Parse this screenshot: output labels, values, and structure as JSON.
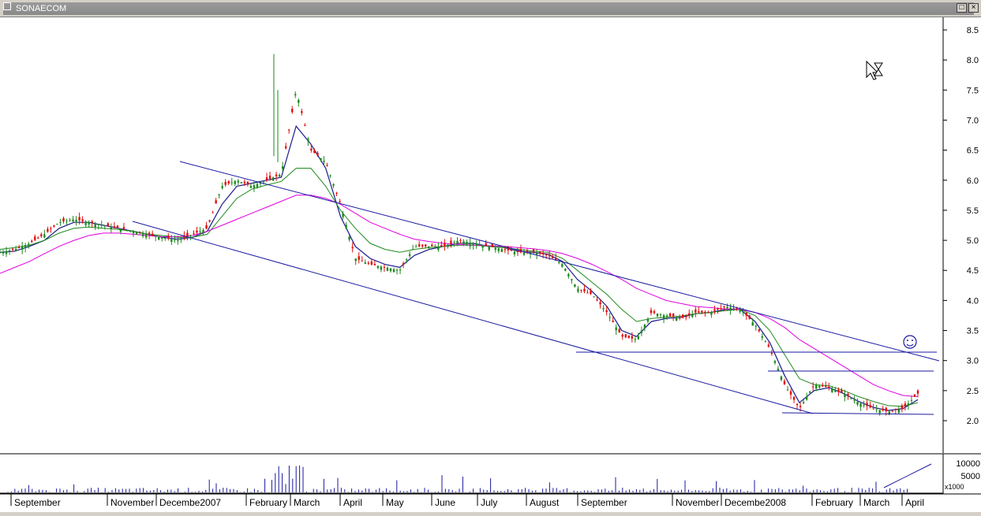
{
  "window": {
    "title": "SONAECOM",
    "restore_icon": "restore-icon",
    "close_icon": "close-icon"
  },
  "chart_data": {
    "type": "candlestick",
    "title": "SONAECOM",
    "xlabel": "",
    "ylabel": "",
    "ylim": [
      1.9,
      8.6
    ],
    "y_ticks": [
      "8.5",
      "8.0",
      "7.5",
      "7.0",
      "6.5",
      "6.0",
      "5.5",
      "5.0",
      "4.5",
      "4.0",
      "3.5",
      "3.0",
      "2.5",
      "2.0"
    ],
    "x_tick_labels": [
      "September",
      "November",
      "Decembe2007",
      "February",
      "March",
      "April",
      "May",
      "June",
      "July",
      "August",
      "September",
      "November",
      "Decembe2008",
      "February",
      "March",
      "April"
    ],
    "x_tick_positions": [
      16,
      138,
      200,
      314,
      370,
      433,
      487,
      549,
      607,
      669,
      734,
      854,
      916,
      1031,
      1092,
      1145
    ],
    "price_series": [
      {
        "name": "close",
        "values": [
          4.8,
          4.85,
          4.95,
          5.1,
          5.3,
          5.35,
          5.3,
          5.25,
          5.2,
          5.15,
          5.1,
          5.05,
          5.0,
          5.1,
          5.2,
          5.9,
          6.0,
          5.9,
          6.0,
          6.1,
          7.5,
          6.5,
          6.3,
          5.6,
          4.7,
          4.6,
          4.55,
          4.5,
          4.9,
          4.9,
          4.9,
          5.0,
          4.95,
          4.9,
          4.85,
          4.8,
          4.8,
          4.75,
          4.6,
          4.2,
          4.1,
          3.8,
          3.4,
          3.35,
          3.8,
          3.75,
          3.7,
          3.8,
          3.8,
          3.9,
          3.85,
          3.6,
          3.2,
          2.6,
          2.2,
          2.6,
          2.55,
          2.45,
          2.3,
          2.2,
          2.15,
          2.2,
          2.45
        ]
      },
      {
        "name": "ma-short",
        "values": [
          4.8,
          4.82,
          4.9,
          5.0,
          5.2,
          5.3,
          5.3,
          5.25,
          5.2,
          5.15,
          5.1,
          5.05,
          5.02,
          5.05,
          5.15,
          5.6,
          5.9,
          5.95,
          6.0,
          6.05,
          6.9,
          6.6,
          6.2,
          5.4,
          4.9,
          4.7,
          4.6,
          4.55,
          4.75,
          4.85,
          4.9,
          4.95,
          4.95,
          4.9,
          4.88,
          4.82,
          4.8,
          4.77,
          4.65,
          4.35,
          4.15,
          3.9,
          3.5,
          3.4,
          3.65,
          3.7,
          3.72,
          3.78,
          3.8,
          3.85,
          3.85,
          3.65,
          3.3,
          2.75,
          2.3,
          2.5,
          2.55,
          2.45,
          2.32,
          2.22,
          2.17,
          2.2,
          2.35
        ]
      },
      {
        "name": "ma-mid",
        "values": [
          4.85,
          4.88,
          4.92,
          5.0,
          5.12,
          5.2,
          5.22,
          5.2,
          5.18,
          5.15,
          5.1,
          5.08,
          5.05,
          5.05,
          5.1,
          5.4,
          5.7,
          5.85,
          5.92,
          5.98,
          6.2,
          6.2,
          5.9,
          5.5,
          5.2,
          4.95,
          4.85,
          4.8,
          4.85,
          4.88,
          4.9,
          4.92,
          4.92,
          4.9,
          4.88,
          4.85,
          4.82,
          4.8,
          4.7,
          4.5,
          4.3,
          4.1,
          3.85,
          3.65,
          3.7,
          3.72,
          3.74,
          3.78,
          3.8,
          3.83,
          3.85,
          3.75,
          3.5,
          3.1,
          2.7,
          2.6,
          2.58,
          2.5,
          2.4,
          2.32,
          2.25,
          2.24,
          2.3
        ]
      },
      {
        "name": "ma-long",
        "values": [
          4.45,
          4.55,
          4.65,
          4.78,
          4.9,
          5.0,
          5.08,
          5.12,
          5.12,
          5.1,
          5.08,
          5.06,
          5.06,
          5.08,
          5.15,
          5.25,
          5.35,
          5.45,
          5.55,
          5.65,
          5.75,
          5.75,
          5.7,
          5.6,
          5.45,
          5.3,
          5.2,
          5.1,
          5.02,
          4.98,
          4.95,
          4.93,
          4.92,
          4.91,
          4.9,
          4.88,
          4.86,
          4.83,
          4.78,
          4.7,
          4.6,
          4.48,
          4.35,
          4.2,
          4.1,
          4.0,
          3.95,
          3.9,
          3.88,
          3.86,
          3.85,
          3.8,
          3.7,
          3.55,
          3.35,
          3.2,
          3.05,
          2.9,
          2.75,
          2.6,
          2.5,
          2.42,
          2.4
        ]
      }
    ],
    "volume": {
      "label": "x1000",
      "ticks": [
        "10000",
        "5000"
      ]
    },
    "trendlines": "descending channel with support lines near 2.1 and resistance near 3.15 and 2.8"
  }
}
